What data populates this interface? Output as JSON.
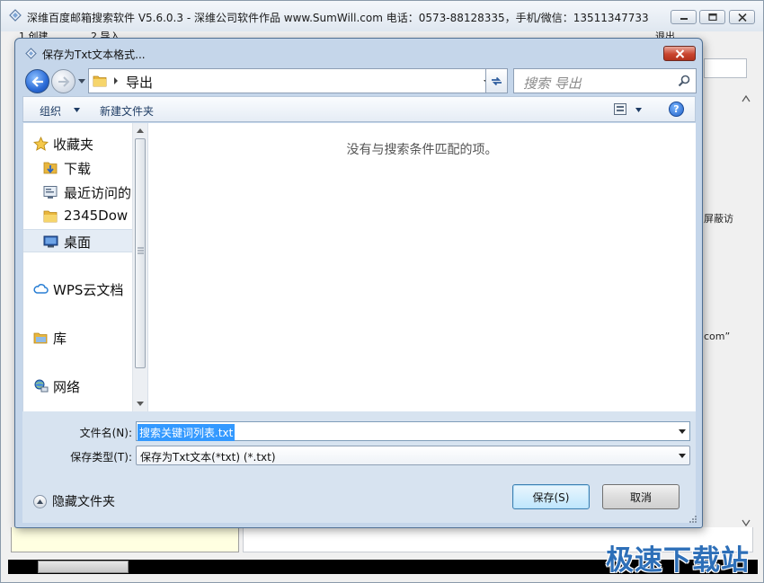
{
  "main_window": {
    "title": "深维百度邮箱搜索软件 V5.6.0.3 - 深维公司软件作品 www.SumWill.com  电话：0573-88128335，手机/微信：13511347733",
    "menu": [
      "1.创建",
      "2.导入",
      "退出"
    ],
    "right_text_1": "屏蔽访",
    "right_text_2": "com”"
  },
  "dialog": {
    "title": "保存为Txt文本格式...",
    "address": {
      "path": "导出",
      "search_placeholder": "搜索 导出"
    },
    "toolbar": {
      "organize": "组织",
      "new_folder": "新建文件夹"
    },
    "nav_items": [
      {
        "label": "收藏夹",
        "icon": "star-icon"
      },
      {
        "label": "下载",
        "icon": "download-folder-icon"
      },
      {
        "label": "最近访问的",
        "icon": "recent-places-icon"
      },
      {
        "label": "2345Dow",
        "icon": "folder-icon"
      },
      {
        "label": "桌面",
        "icon": "desktop-icon",
        "selected": true
      },
      {
        "label": "WPS云文档",
        "icon": "cloud-icon"
      },
      {
        "label": "库",
        "icon": "library-icon"
      },
      {
        "label": "网络",
        "icon": "network-icon"
      }
    ],
    "empty_message": "没有与搜索条件匹配的项。",
    "file_name": {
      "label": "文件名(N):",
      "value": "搜索关键词列表.txt"
    },
    "file_type": {
      "label": "保存类型(T):",
      "value": "保存为Txt文本(*txt) (*.txt)"
    },
    "hide_folders": "隐藏文件夹",
    "save_button": "保存(S)",
    "cancel_button": "取消"
  },
  "watermark": "极速下载站"
}
